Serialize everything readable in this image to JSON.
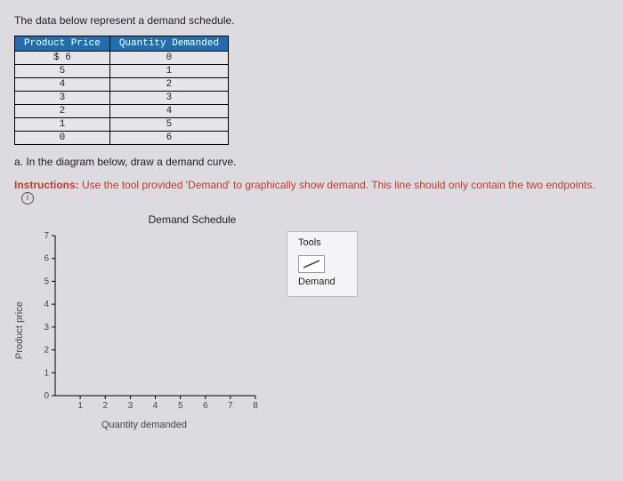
{
  "intro": "The data below represent a demand schedule.",
  "table": {
    "head_price": "Product Price",
    "head_qty": "Quantity Demanded",
    "rows": [
      {
        "price": "$ 6",
        "qty": "0"
      },
      {
        "price": "5",
        "qty": "1"
      },
      {
        "price": "4",
        "qty": "2"
      },
      {
        "price": "3",
        "qty": "3"
      },
      {
        "price": "2",
        "qty": "4"
      },
      {
        "price": "1",
        "qty": "5"
      },
      {
        "price": "0",
        "qty": "6"
      }
    ]
  },
  "part_a": "a. In the diagram below, draw a demand curve.",
  "instructions_label": "Instructions:",
  "instructions_text": " Use the tool provided 'Demand' to graphically show demand. This line should only contain the two endpoints.",
  "info_icon_char": "i",
  "tools": {
    "header": "Tools",
    "item": "Demand"
  },
  "chart_data": {
    "type": "scatter",
    "title": "Demand Schedule",
    "xlabel": "Quantity demanded",
    "ylabel": "Product price",
    "xlim": [
      0,
      8
    ],
    "ylim": [
      0,
      7
    ],
    "xticks": [
      1,
      2,
      3,
      4,
      5,
      6,
      7,
      8
    ],
    "yticks": [
      0,
      1,
      2,
      3,
      4,
      5,
      6,
      7
    ],
    "series": []
  }
}
